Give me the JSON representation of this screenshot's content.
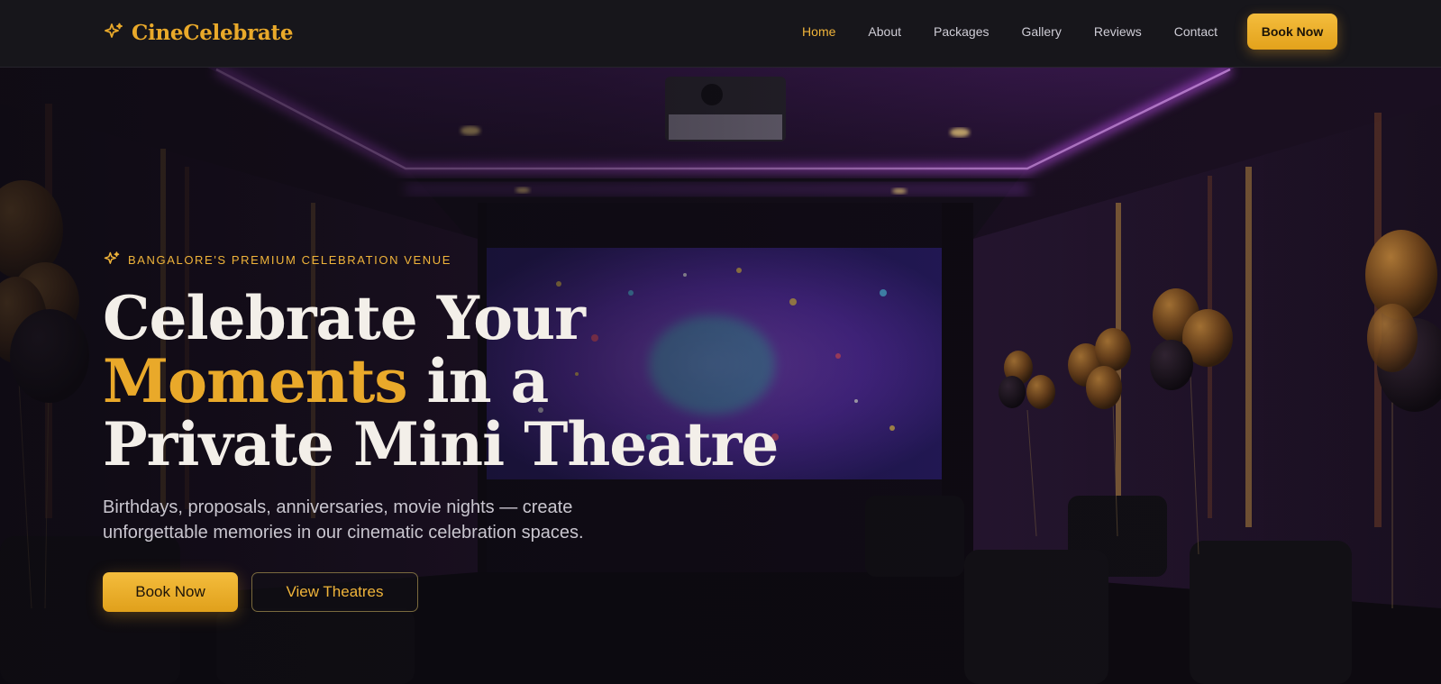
{
  "brand": {
    "name": "CineCelebrate",
    "icon": "sparkles-icon"
  },
  "nav": {
    "items": [
      {
        "label": "Home",
        "active": true
      },
      {
        "label": "About",
        "active": false
      },
      {
        "label": "Packages",
        "active": false
      },
      {
        "label": "Gallery",
        "active": false
      },
      {
        "label": "Reviews",
        "active": false
      },
      {
        "label": "Contact",
        "active": false
      }
    ],
    "cta_label": "Book Now"
  },
  "hero": {
    "eyebrow": "BANGALORE'S PREMIUM CELEBRATION VENUE",
    "headline": {
      "line1": "Celebrate Your",
      "accent": "Moments",
      "line2_rest": " in a",
      "line3": "Private Mini Theatre"
    },
    "subtext": "Birthdays, proposals, anniversaries, movie nights — create unforgettable memories in our cinematic celebration spaces.",
    "primary_button": "Book Now",
    "secondary_button": "View Theatres",
    "background": "private-theatre-photo"
  },
  "colors": {
    "accent": "#e9a92a",
    "nav_background": "#17161b",
    "neon": "#b23ee0",
    "text_light": "#f3efe9"
  }
}
